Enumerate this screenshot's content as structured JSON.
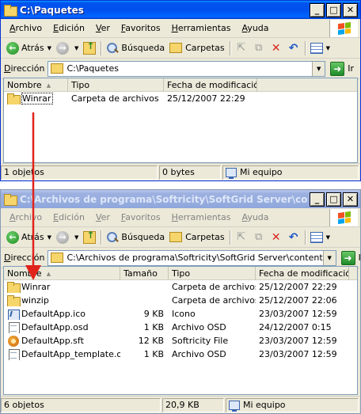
{
  "windows": [
    {
      "title": "C:\\Paquetes",
      "menu": [
        "Archivo",
        "Edición",
        "Ver",
        "Favoritos",
        "Herramientas",
        "Ayuda"
      ],
      "toolbar": {
        "back": "Atrás",
        "search": "Búsqueda",
        "folders": "Carpetas"
      },
      "address": {
        "label": "Dirección",
        "value": "C:\\Paquetes",
        "go": "Ir"
      },
      "columns": [
        "Nombre",
        "Tipo",
        "Fecha de modificación"
      ],
      "rows": [
        {
          "name": "Winrar",
          "type": "Carpeta de archivos",
          "date": "25/12/2007 22:29"
        }
      ],
      "status": {
        "count": "1 objetos",
        "size": "0 bytes",
        "location": "Mi equipo"
      }
    },
    {
      "title": "C:\\Archivos de programa\\Softricity\\SoftGrid Server\\content",
      "menu": [
        "Archivo",
        "Edición",
        "Ver",
        "Favoritos",
        "Herramientas",
        "Ayuda"
      ],
      "toolbar": {
        "back": "Atrás",
        "search": "Búsqueda",
        "folders": "Carpetas"
      },
      "address": {
        "label": "Dirección",
        "value": "C:\\Archivos de programa\\Softricity\\SoftGrid Server\\content",
        "go": "Ir"
      },
      "columns": [
        "Nombre",
        "Tamaño",
        "Tipo",
        "Fecha de modificación"
      ],
      "rows": [
        {
          "name": "Winrar",
          "size": "",
          "type": "Carpeta de archivos",
          "date": "25/12/2007 22:29"
        },
        {
          "name": "winzip",
          "size": "",
          "type": "Carpeta de archivos",
          "date": "25/12/2007 22:06"
        },
        {
          "name": "DefaultApp.ico",
          "size": "9 KB",
          "type": "Icono",
          "date": "23/03/2007 12:59"
        },
        {
          "name": "DefaultApp.osd",
          "size": "1 KB",
          "type": "Archivo OSD",
          "date": "24/12/2007 0:15"
        },
        {
          "name": "DefaultApp.sft",
          "size": "12 KB",
          "type": "Softricity File",
          "date": "23/03/2007 12:59"
        },
        {
          "name": "DefaultApp_template.osd",
          "size": "1 KB",
          "type": "Archivo OSD",
          "date": "23/03/2007 12:59"
        }
      ],
      "status": {
        "count": "6 objetos",
        "size": "20,9 KB",
        "location": "Mi equipo"
      }
    }
  ],
  "icons": {
    "rows_window2": [
      "folder-icon",
      "folder-icon",
      "app-icon",
      "file-icon",
      "sft-icon",
      "file-icon"
    ]
  },
  "colors": {
    "annotation_arrow": "#e0241c",
    "title_active": "#0054e3",
    "title_inactive": "#9db1e0"
  }
}
